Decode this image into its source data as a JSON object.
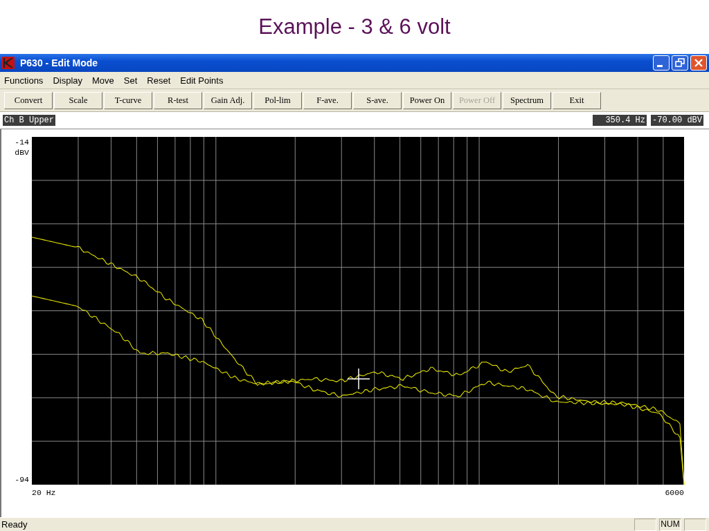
{
  "slide_title": "Example - 3 & 6 volt",
  "window": {
    "title": "P630 - Edit Mode"
  },
  "menu": [
    "Functions",
    "Display",
    "Move",
    "Set",
    "Reset",
    "Edit Points"
  ],
  "toolbar": [
    {
      "label": "Convert",
      "disabled": false
    },
    {
      "label": "Scale",
      "disabled": false
    },
    {
      "label": "T-curve",
      "disabled": false
    },
    {
      "label": "R-test",
      "disabled": false
    },
    {
      "label": "Gain Adj.",
      "disabled": false
    },
    {
      "label": "Pol-lim",
      "disabled": false
    },
    {
      "label": "F-ave.",
      "disabled": false
    },
    {
      "label": "S-ave.",
      "disabled": false
    },
    {
      "label": "Power On",
      "disabled": false
    },
    {
      "label": "Power Off",
      "disabled": true
    },
    {
      "label": "Spectrum",
      "disabled": false
    },
    {
      "label": "Exit",
      "disabled": false
    }
  ],
  "info": {
    "channel": "Ch B Upper",
    "frequency": "350.4 Hz",
    "level": "-70.00 dBV"
  },
  "chart": {
    "y_top_label": "-14",
    "y_unit": "dBV",
    "y_bottom_label": "-94",
    "x_start_label": "20 Hz",
    "x_end_label": "6000"
  },
  "status_bar": {
    "text": "Ready",
    "indicator": "NUM"
  }
}
